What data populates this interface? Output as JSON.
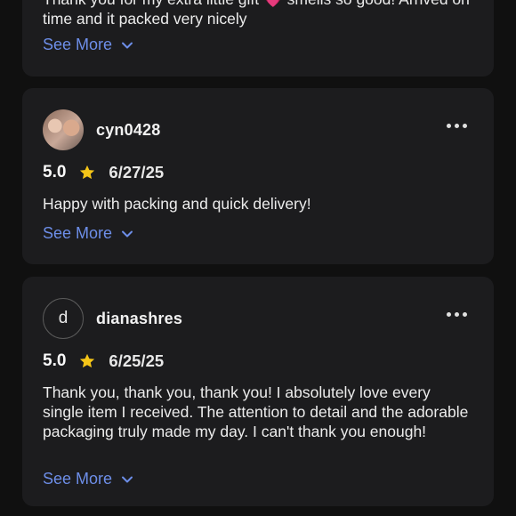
{
  "reviews": [
    {
      "text_clipped": "Thank you for my extra little gift 💗 smells so good! Arrived on time and it packed very nicely",
      "see_more": "See More"
    },
    {
      "username": "cyn0428",
      "avatar": "photo",
      "rating": "5.0",
      "date": "6/27/25",
      "text": "Happy with packing and quick delivery!",
      "see_more": "See More"
    },
    {
      "username": "dianashres",
      "avatar_letter": "d",
      "rating": "5.0",
      "date": "6/25/25",
      "text": "Thank you, thank you, thank you! I absolutely love every single item I received. The attention to detail and the adorable packaging truly made my day. I can't thank you enough!",
      "see_more": "See More"
    }
  ],
  "colors": {
    "background": "#101010",
    "card": "#1c1c1e",
    "link": "#6d8ee8",
    "star": "#f5c518"
  },
  "icons": {
    "star": "star-icon",
    "chevron": "chevron-down-icon",
    "more": "more-options-icon"
  }
}
